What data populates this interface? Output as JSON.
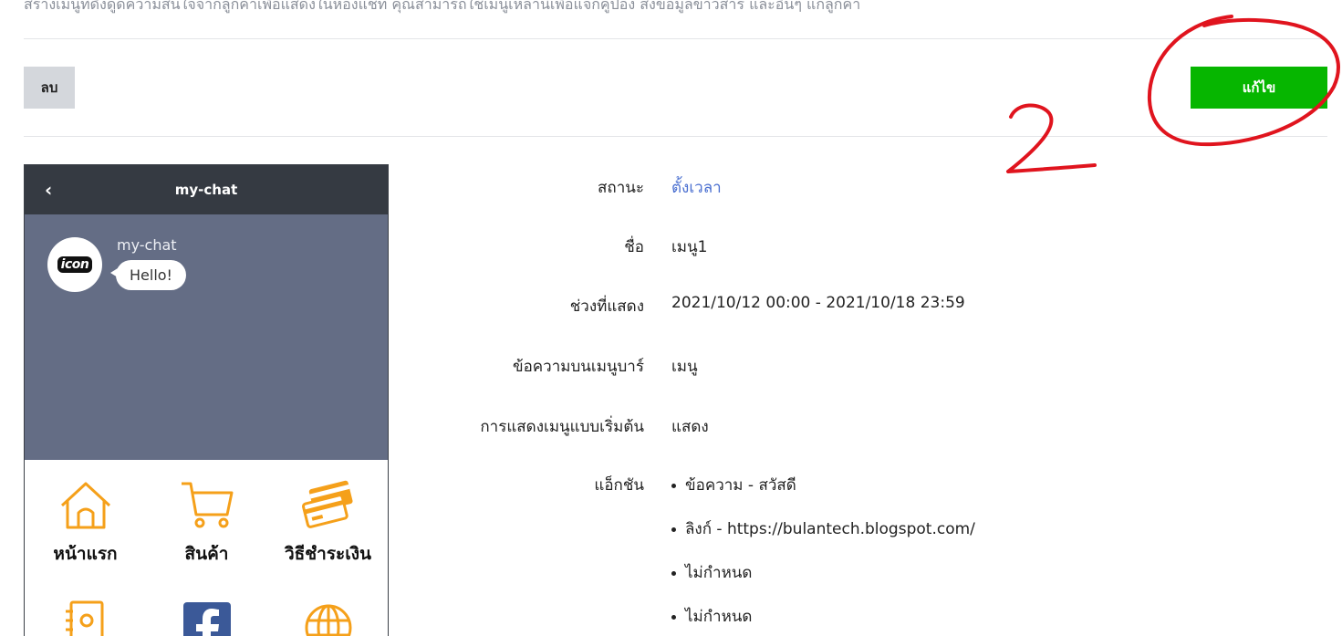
{
  "intro_text": "สร้างเมนูที่ดึงดูดความสนใจจากลูกค้าเพื่อแสดงในห้องแชท คุณสามารถใช้เมนูเหล่านี้เพื่อแจกคูปอง ส่งข้อมูลข่าวสาร และอื่นๆ แก่ลูกค้า",
  "toolbar": {
    "delete_label": "ลบ",
    "edit_label": "แก้ไข"
  },
  "annotation_text": "2",
  "colors": {
    "edit_button": "#06b600",
    "chat_background": "#646d85",
    "header": "#353a42",
    "menu_icon": "#f5a01a",
    "link": "#4a6fd0",
    "annotation": "#e0141e"
  },
  "phone": {
    "back_icon": "chevron-left-icon",
    "title": "my-chat",
    "sender": "my-chat",
    "avatar_text": "icon",
    "message": "Hello!",
    "menu_items": [
      {
        "label": "หน้าแรก",
        "icon": "home-icon"
      },
      {
        "label": "สินค้า",
        "icon": "cart-icon"
      },
      {
        "label": "วิธีชำระเงิน",
        "icon": "credit-card-icon"
      },
      {
        "label": "",
        "icon": "contact-book-icon"
      },
      {
        "label": "",
        "icon": "facebook-icon"
      },
      {
        "label": "",
        "icon": "globe-icon"
      }
    ]
  },
  "details": {
    "status_label": "สถานะ",
    "status_value": "ตั้งเวลา",
    "name_label": "ชื่อ",
    "name_value": "เมนู1",
    "period_label": "ช่วงที่แสดง",
    "period_value": "2021/10/12 00:00 - 2021/10/18 23:59",
    "menubar_label": "ข้อความบนเมนูบาร์",
    "menubar_value": "เมนู",
    "default_label": "การแสดงเมนูแบบเริ่มต้น",
    "default_value": "แสดง",
    "actions_label": "แอ็กชัน",
    "actions": [
      "ข้อความ - สวัสดี",
      "ลิงก์ - https://bulantech.blogspot.com/",
      "ไม่กำหนด",
      "ไม่กำหนด"
    ]
  }
}
